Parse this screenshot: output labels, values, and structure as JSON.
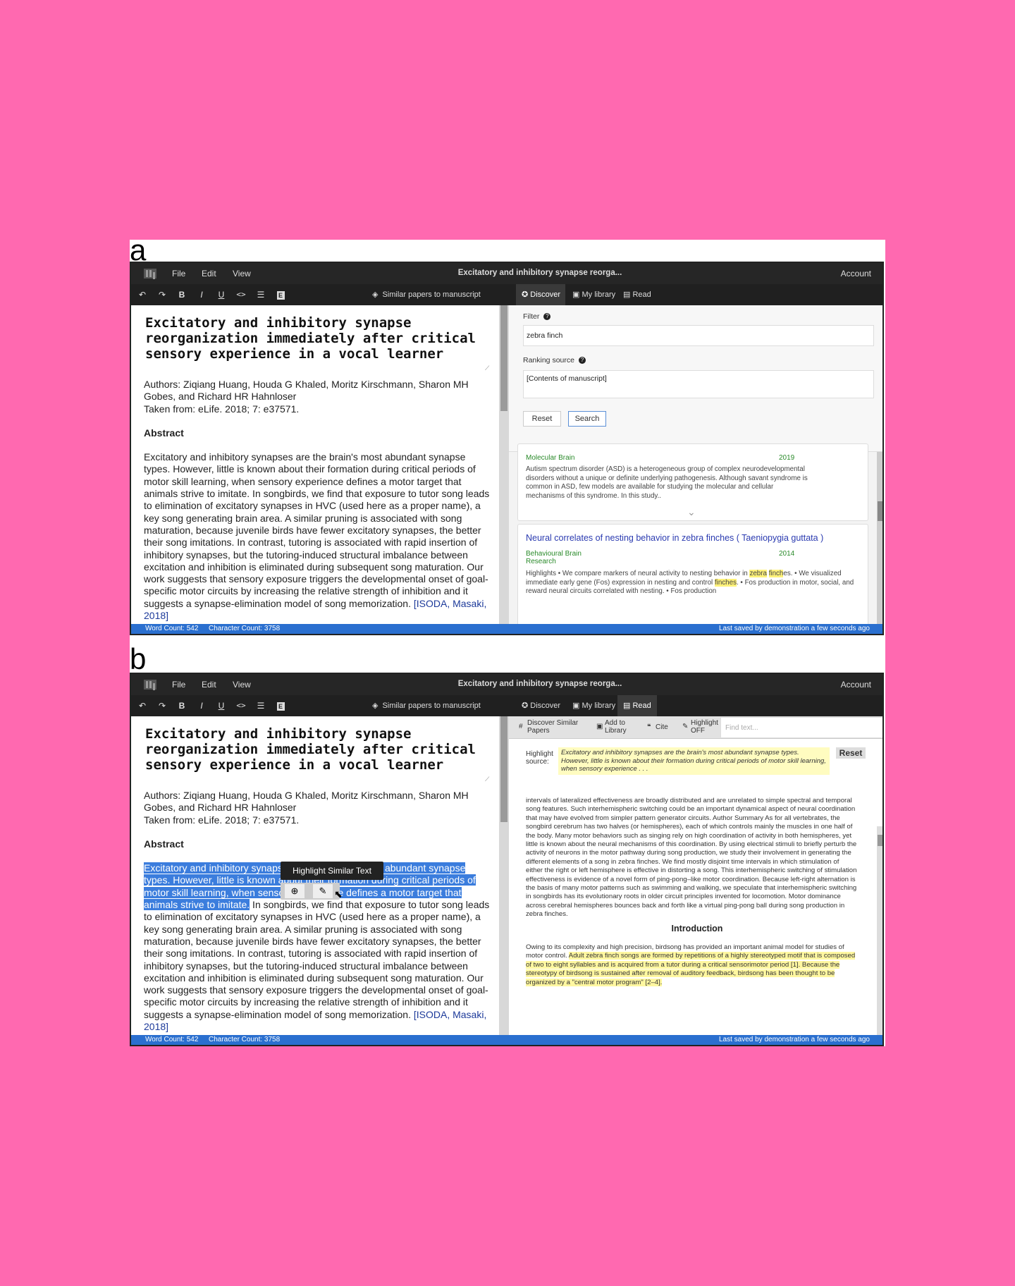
{
  "panel_labels": {
    "a": "a",
    "b": "b"
  },
  "menubar": {
    "logo": "grid-logo-icon",
    "file": "File",
    "edit": "Edit",
    "view": "View",
    "title": "Excitatory and inhibitory synapse reorga...",
    "account": "Account"
  },
  "toolbar": {
    "undo": "↶",
    "redo": "↷",
    "bold": "B",
    "italic": "I",
    "underline": "U",
    "code": "<>",
    "list": "☰",
    "block": "E",
    "similar_icon": "◈",
    "similar": "Similar papers to manuscript"
  },
  "tabs": {
    "discover": "Discover",
    "library": "My library",
    "read": "Read",
    "discover_icon": "✪",
    "library_icon": "▣",
    "read_icon": "▤"
  },
  "document": {
    "title": "Excitatory and inhibitory synapse reorganization immediately after critical sensory experience in a vocal learner",
    "authors": "Authors: Ziqiang Huang, Houda G Khaled, Moritz Kirschmann, Sharon MH Gobes, and Richard HR Hahnloser",
    "source": "Taken from: eLife. 2018; 7: e37571.",
    "abstract_heading": "Abstract",
    "abstract_sel": "Excitatory and inhibitory synapses are the brain's most abundant synapse types. However, little is known about their formation during critical periods of motor skill learning, when sensory experience defines a motor target that animals strive to imitate.",
    "abstract_rest": " In songbirds, we find that exposure to tutor song leads to elimination of excitatory synapses in HVC (used here as a proper name), a key song generating brain area. A similar pruning is associated with song maturation, because juvenile birds have fewer excitatory synapses, the better their song imitations. In contrast, tutoring is associated with rapid insertion of inhibitory synapses, but the tutoring-induced structural imbalance between excitation and inhibition is eliminated during subsequent song maturation. Our work suggests that sensory exposure triggers the developmental onset of goal-specific motor circuits by increasing the relative strength of inhibition and it suggests a synapse-elimination model of song memorization. ",
    "citation": "[ISODA, Masaki, 2018]"
  },
  "status": {
    "word_count": "Word Count: 542",
    "char_count": "Character Count: 3758",
    "last_saved": "Last saved by demonstration a few seconds ago"
  },
  "discover": {
    "filter_label": "Filter",
    "filter_value": "zebra finch",
    "ranking_label": "Ranking source",
    "ranking_value": "[Contents of manuscript]",
    "reset": "Reset",
    "search": "Search",
    "help_icon": "?",
    "results": [
      {
        "journal": "Molecular Brain",
        "year": "2019",
        "abstract": "Autism spectrum disorder (ASD) is a heterogeneous group of complex neurodevelopmental disorders without a unique or definite underlying pathogenesis. Although savant syndrome is common in ASD, few models are available for studying the molecular and cellular mechanisms of this syndrome. In this study..",
        "expand_icon": "⌄"
      },
      {
        "title": "Neural correlates of nesting behavior in zebra finches ( Taeniopygia guttata )",
        "journal": "Behavioural Brain Research",
        "year": "2014",
        "hl_prefix": "Highlights • We compare markers of neural activity to nesting behavior in ",
        "hl_1": "zebra",
        "hl_gap": " ",
        "hl_2": "finch",
        "hl_mid": "es. • We visualized immediate early gene (Fos) expression in nesting and control ",
        "hl_3": "finches",
        "hl_suffix": ". • Fos production in motor, social, and reward neural circuits correlated with nesting. • Fos production"
      }
    ]
  },
  "reader": {
    "discover_similar": "Discover Similar Papers",
    "add_library": "Add to Library",
    "cite": "Cite",
    "highlight_off": "Highlight OFF",
    "find_placeholder": "Find text...",
    "highlight_source_label": "Highlight source:",
    "highlight_source": "Excitatory and inhibitory synapses are the brain's most abundant synapse types. However, little is known about their formation during critical periods of motor skill learning, when sensory experience . . .",
    "reset": "Reset",
    "body": "intervals of lateralized effectiveness are broadly distributed and are unrelated to simple spectral and temporal song features. Such interhemispheric switching could be an important dynamical aspect of neural coordination that may have evolved from simpler pattern generator circuits. Author Summary As for all vertebrates, the songbird cerebrum has two halves (or hemispheres), each of which controls mainly the muscles in one half of the body. Many motor behaviors such as singing rely on high coordination of activity in both hemispheres, yet little is known about the neural mechanisms of this coordination. By using electrical stimuli to briefly perturb the activity of neurons in the motor pathway during song production, we study their involvement in generating the different elements of a song in zebra finches. We find mostly disjoint time intervals in which stimulation of either the right or left hemisphere is effective in distorting a song. This interhemispheric switching of stimulation effectiveness is evidence of a novel form of ping-pong–like motor coordination. Because left-right alternation is the basis of many motor patterns such as swimming and walking, we speculate that interhemispheric switching in songbirds has its evolutionary roots in older circuit principles invented for locomotion. Motor dominance across cerebral hemispheres bounces back and forth like a virtual ping-pong ball during song production in zebra finches.",
    "intro_heading": "Introduction",
    "intro_a": "Owing to its complexity and high precision, birdsong has provided an important animal model for studies of motor control. ",
    "intro_hl": "Adult zebra finch songs are formed by repetitions of a highly stereotyped motif that is composed of two to eight syllables and is acquired from a tutor during a critical sensorimotor period [1]. Because the stereotypy of birdsong is sustained after removal of auditory feedback, birdsong has been thought to be organized by a \"central motor program\" [2–4].",
    "tool_icons": {
      "discover": "#",
      "library": "▣",
      "cite": "❝",
      "highlight": "✎"
    }
  },
  "tooltip": {
    "text": "Highlight Similar Text",
    "zoom_icon": "⊕",
    "highlighter_icon": "✎",
    "cursor_icon": "⬉"
  }
}
